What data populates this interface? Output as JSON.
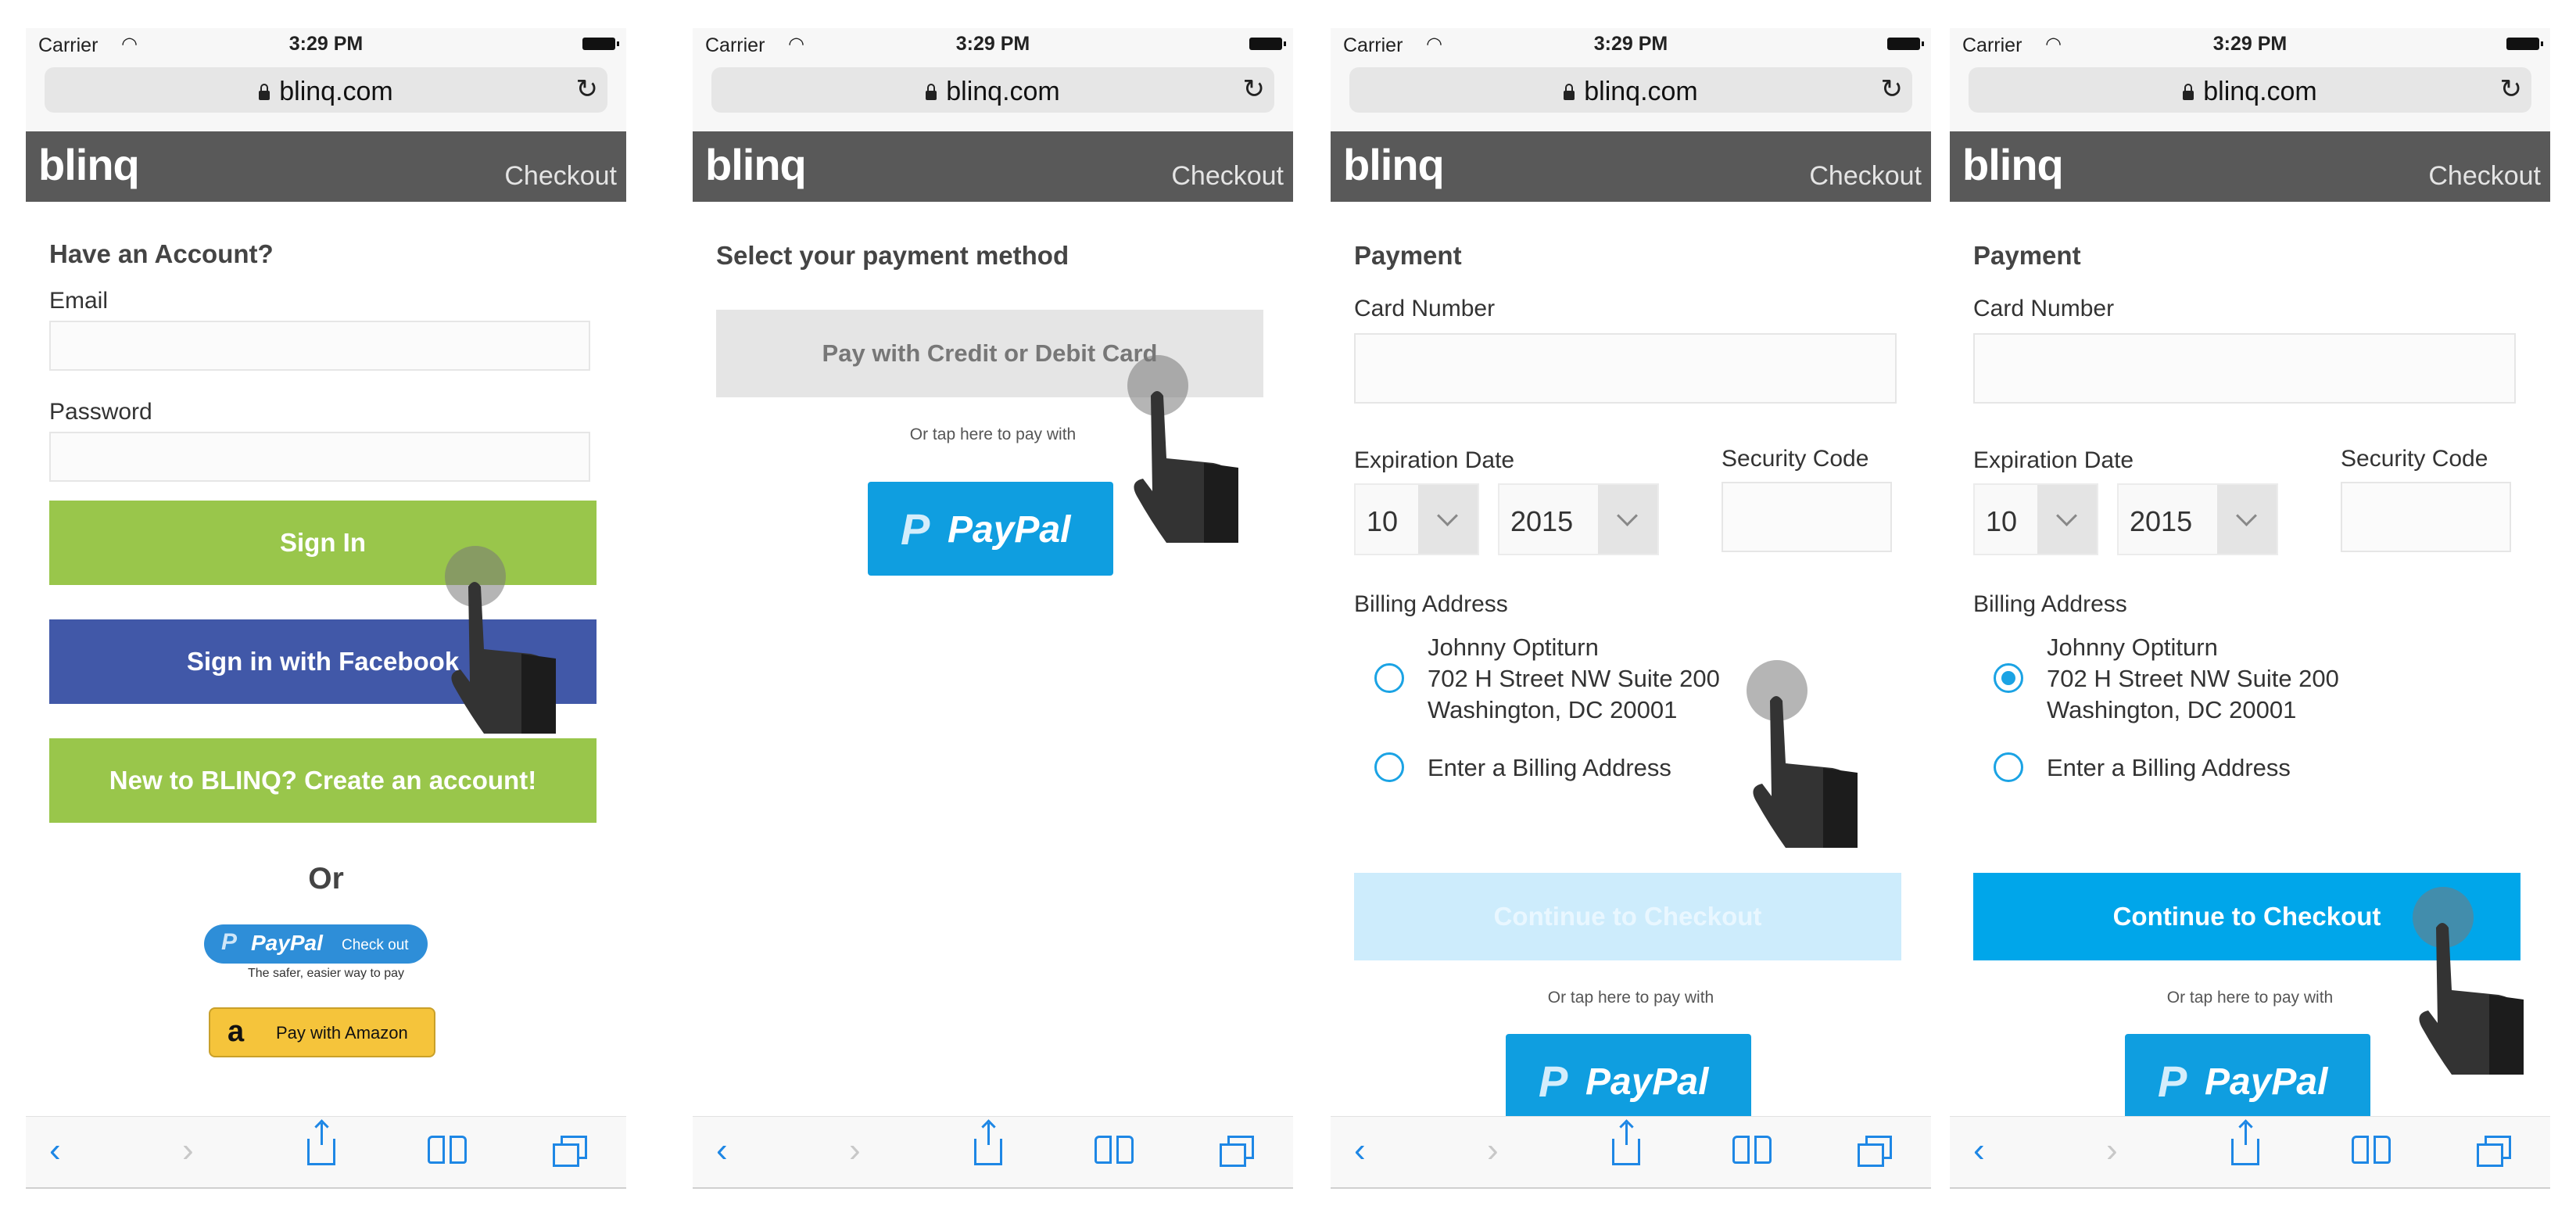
{
  "browser": {
    "carrier": "Carrier",
    "time": "3:29 PM",
    "url": "blinq.com"
  },
  "header": {
    "logo": "blinq",
    "title": "Checkout"
  },
  "screen1": {
    "heading": "Have an Account?",
    "email_label": "Email",
    "password_label": "Password",
    "sign_in": "Sign In",
    "facebook": "Sign in with Facebook",
    "create_account": "New to BLINQ? Create an account!",
    "or": "Or",
    "paypal_word": "PayPal",
    "paypal_check": "Check out",
    "paypal_tagline": "The safer, easier way to pay",
    "amazon": "Pay with Amazon"
  },
  "screen2": {
    "heading": "Select your payment method",
    "card_button": "Pay with Credit or Debit Card",
    "or_tap": "Or tap here to pay with",
    "paypal_word": "PayPal"
  },
  "payment": {
    "heading": "Payment",
    "card_number_label": "Card Number",
    "expiration_label": "Expiration Date",
    "security_label": "Security Code",
    "month": "10",
    "year": "2015",
    "billing_label": "Billing Address",
    "address": [
      "Johnny Optiturn",
      "702 H Street NW Suite 200",
      "Washington, DC 20001"
    ],
    "enter_billing": "Enter a Billing Address",
    "continue": "Continue to Checkout",
    "or_tap": "Or tap here to pay with",
    "paypal_word": "PayPal"
  },
  "colors": {
    "header_bg": "#595959",
    "green": "#99c64b",
    "facebook_blue": "#4158a8",
    "paypal_blue": "#0f9ee0",
    "cta_enabled": "#00a6ea",
    "cta_disabled": "#cdecfc"
  },
  "icons": {
    "back": "chevron-left-icon",
    "forward": "chevron-right-icon",
    "share": "share-icon",
    "bookmarks": "book-icon",
    "tabs": "tabs-icon",
    "lock": "lock-icon",
    "reload": "reload-icon",
    "cursor": "hand-pointer-icon"
  }
}
